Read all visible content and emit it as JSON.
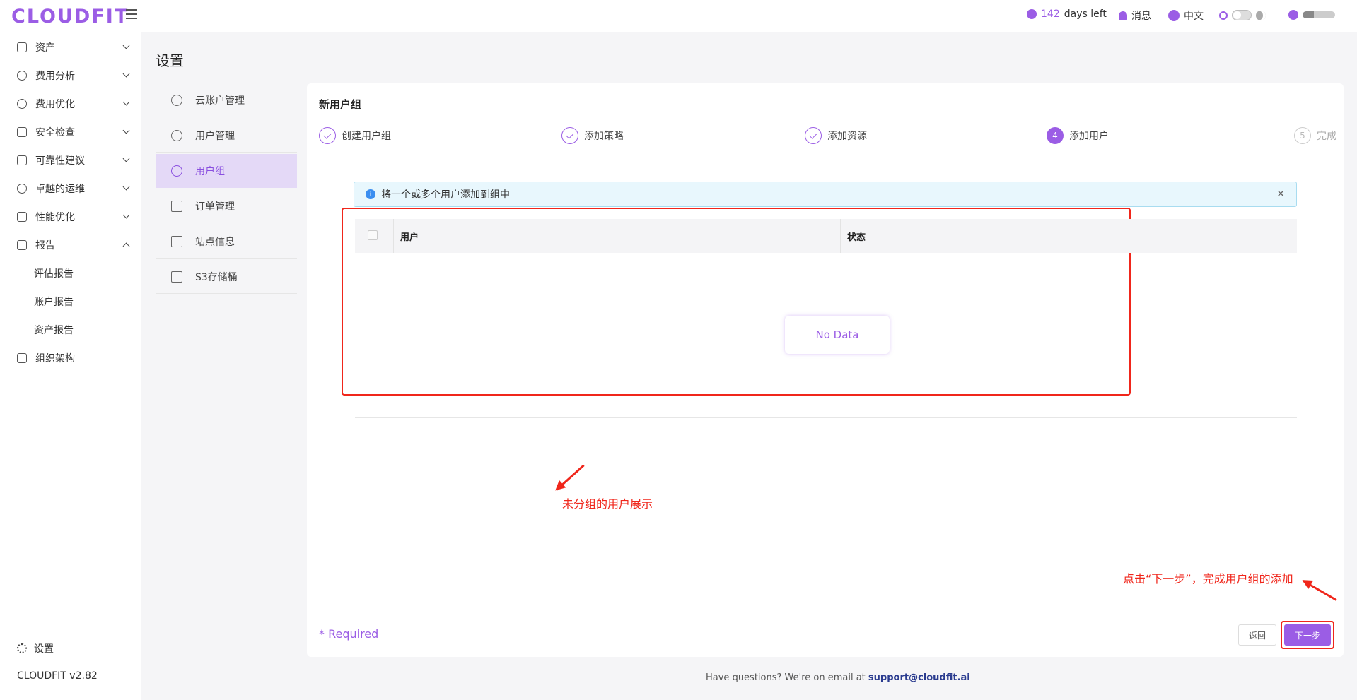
{
  "header": {
    "logo": "CLOUDFIT",
    "trial_days": "142",
    "trial_suffix": "days left",
    "messages": "消息",
    "language": "中文"
  },
  "sidebar": {
    "items": [
      {
        "label": "资产",
        "icon": "asset-icon"
      },
      {
        "label": "费用分析",
        "icon": "dashboard-icon"
      },
      {
        "label": "费用优化",
        "icon": "dollar-icon"
      },
      {
        "label": "安全检查",
        "icon": "alarm-icon"
      },
      {
        "label": "可靠性建议",
        "icon": "reliability-icon"
      },
      {
        "label": "卓越的运维",
        "icon": "cloud-ops-icon"
      },
      {
        "label": "性能优化",
        "icon": "performance-icon"
      },
      {
        "label": "报告",
        "icon": "report-icon"
      }
    ],
    "report_children": [
      "评估报告",
      "账户报告",
      "资产报告"
    ],
    "org": {
      "label": "组织架构",
      "icon": "org-chart-icon"
    },
    "settings": "设置",
    "version": "CLOUDFIT v2.82"
  },
  "page": {
    "title": "设置"
  },
  "settings_menu": [
    {
      "label": "云账户管理",
      "icon": "cloud-icon"
    },
    {
      "label": "用户管理",
      "icon": "user-icon"
    },
    {
      "label": "用户组",
      "icon": "user-group-icon",
      "active": true
    },
    {
      "label": "订单管理",
      "icon": "clipboard-icon"
    },
    {
      "label": "站点信息",
      "icon": "site-info-icon"
    },
    {
      "label": "S3存储桶",
      "icon": "bucket-icon"
    }
  ],
  "card": {
    "title": "新用户组",
    "steps": [
      {
        "label": "创建用户组",
        "status": "done"
      },
      {
        "label": "添加策略",
        "status": "done"
      },
      {
        "label": "添加资源",
        "status": "done"
      },
      {
        "label": "添加用户",
        "status": "current",
        "number": "4"
      },
      {
        "label": "完成",
        "status": "todo",
        "number": "5"
      }
    ],
    "alert": "将一个或多个用户添加到组中",
    "table": {
      "columns": [
        "用户",
        "状态"
      ],
      "empty": "No Data"
    },
    "required": "* Required",
    "back_label": "返回",
    "next_label": "下一步"
  },
  "annotations": {
    "table_note": "未分组的用户展示",
    "next_note": "点击“下一步”，完成用户组的添加"
  },
  "footer": {
    "text": "Have questions? We're on email at",
    "email": "support@cloudfit.ai"
  },
  "colors": {
    "accent": "#9b5de5",
    "annotation": "#f0261b",
    "info": "#3b8ef0"
  }
}
